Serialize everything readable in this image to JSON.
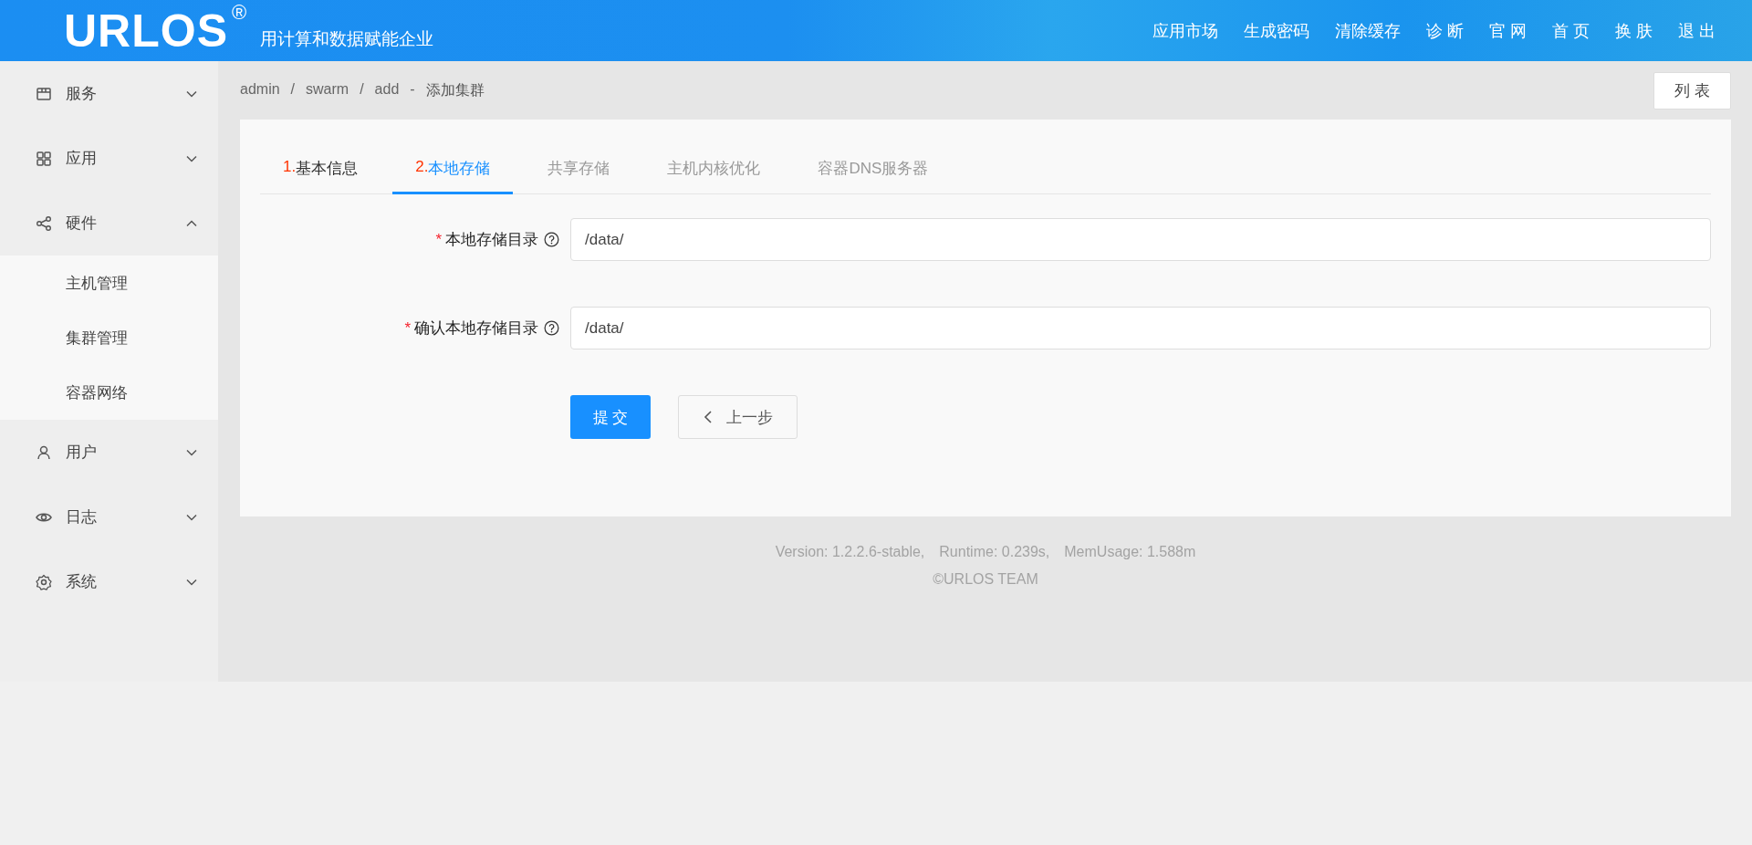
{
  "header": {
    "logo": "URLOS",
    "logo_mark": "®",
    "slogan": "用计算和数据赋能企业",
    "nav": [
      "应用市场",
      "生成密码",
      "清除缓存",
      "诊 断",
      "官 网",
      "首 页",
      "换 肤",
      "退 出"
    ]
  },
  "sidebar": {
    "items": [
      {
        "label": "服务",
        "expanded": false
      },
      {
        "label": "应用",
        "expanded": false
      },
      {
        "label": "硬件",
        "expanded": true,
        "children": [
          {
            "label": "主机管理",
            "selected": false
          },
          {
            "label": "集群管理",
            "selected": false
          },
          {
            "label": "容器网络",
            "selected": false
          }
        ]
      },
      {
        "label": "用户",
        "expanded": false
      },
      {
        "label": "日志",
        "expanded": false
      },
      {
        "label": "系统",
        "expanded": false
      }
    ]
  },
  "breadcrumb": {
    "parts": [
      "admin",
      "swarm",
      "add"
    ],
    "separator": "/",
    "title_separator": "-",
    "title": "添加集群"
  },
  "list_button": "列 表",
  "tabs": [
    {
      "number": "1.",
      "label": "基本信息",
      "selected": false,
      "disabled": false
    },
    {
      "number": "2.",
      "label": "本地存储",
      "selected": true,
      "disabled": false
    },
    {
      "label": "共享存储",
      "selected": false,
      "disabled": true
    },
    {
      "label": "主机内核优化",
      "selected": false,
      "disabled": true
    },
    {
      "label": "容器DNS服务器",
      "selected": false,
      "disabled": true
    }
  ],
  "form": {
    "required_mark": "*",
    "fields": [
      {
        "label": "本地存储目录",
        "required": true,
        "value": "/data/"
      },
      {
        "label": "确认本地存储目录",
        "required": true,
        "value": "/data/"
      }
    ],
    "submit": "提 交",
    "back": "上一步"
  },
  "footer": {
    "stats": [
      "Version: 1.2.2.6-stable,",
      "Runtime: 0.239s,",
      "MemUsage: 1.588m"
    ],
    "copyright": "©URLOS TEAM"
  }
}
